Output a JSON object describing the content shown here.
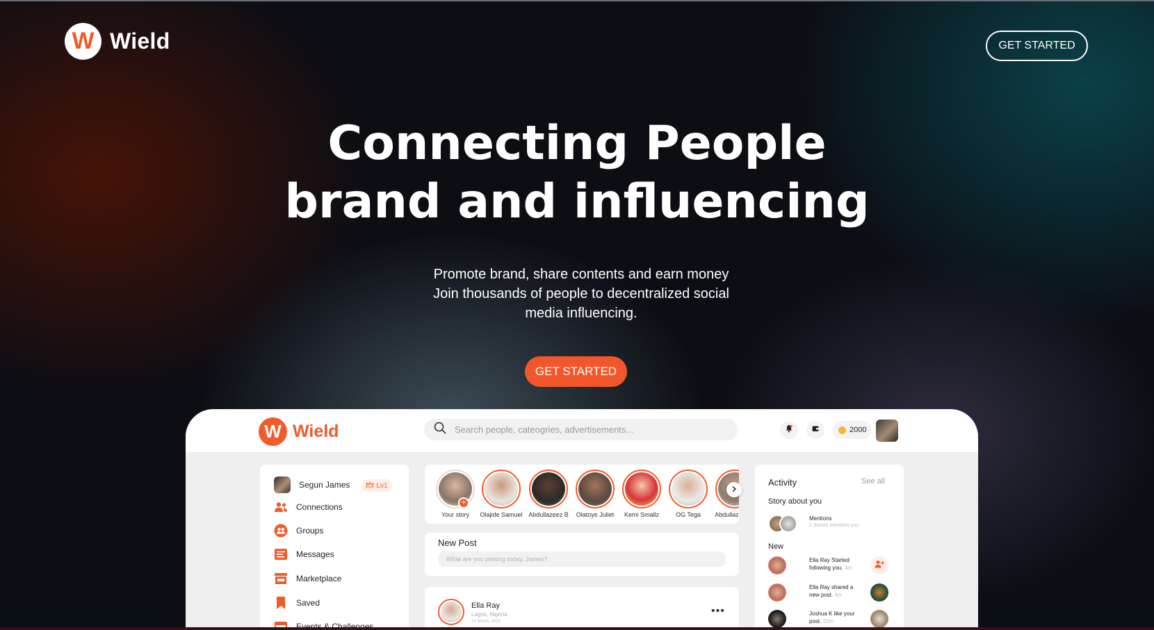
{
  "brand": {
    "logo_letter": "W",
    "name": "Wield",
    "accent": "#f15a29"
  },
  "header": {
    "cta_label": "GET STARTED"
  },
  "hero": {
    "title_line1": "Connecting People",
    "title_line2": "brand and influencing",
    "subtitle_line1": "Promote brand, share contents and earn money",
    "subtitle_line2": "Join thousands of people to decentralized social",
    "subtitle_line3": "media influencing.",
    "cta_label": "GET STARTED"
  },
  "app": {
    "logo_letter": "W",
    "logo_text": "Wield",
    "search_placeholder": "Search people, cateogries, advertisements...",
    "coins": "2000",
    "icons": [
      "bell-icon",
      "wallet-icon",
      "coin-icon"
    ],
    "sidebar": {
      "user_name": "Segun James",
      "level": "Lv1",
      "items": [
        {
          "label": "Connections",
          "icon": "connections-icon"
        },
        {
          "label": "Groups",
          "icon": "groups-icon"
        },
        {
          "label": "Messages",
          "icon": "messages-icon"
        },
        {
          "label": "Marketplace",
          "icon": "marketplace-icon"
        },
        {
          "label": "Saved",
          "icon": "bookmark-icon"
        },
        {
          "label": "Events & Challenges",
          "icon": "calendar-icon"
        }
      ]
    },
    "stories": [
      {
        "name": "Your story"
      },
      {
        "name": "Olajide Samuel"
      },
      {
        "name": "Abdullazeez B"
      },
      {
        "name": "Olatoye Juliet"
      },
      {
        "name": "Kemi Smallz"
      },
      {
        "name": "OG Tega"
      },
      {
        "name": "Abdullazeez B"
      }
    ],
    "new_post": {
      "title": "New Post",
      "placeholder": "What are you posting today, James?"
    },
    "post": {
      "author": "Ella Ray",
      "location": "Lagos, Nigeria.",
      "date": "24 March, 2023",
      "more": "•••"
    },
    "activity": {
      "title": "Activity",
      "see_all": "See all",
      "story_heading": "Story about you",
      "mentions_title": "Mentions",
      "mentions_sub": "2 Stories mentions you",
      "new_heading": "New",
      "items": [
        {
          "text": "Ella Ray Started following you.",
          "time": "4m"
        },
        {
          "text": "Ella Ray shared a new post.",
          "time": "4m"
        },
        {
          "text": "Joshua K like your post.",
          "time": "10m"
        }
      ]
    }
  }
}
